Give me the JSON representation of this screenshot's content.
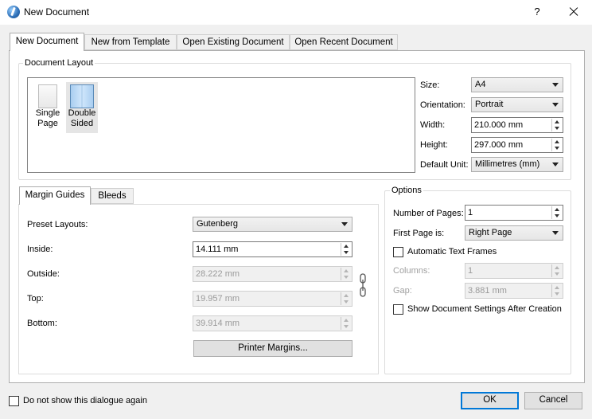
{
  "window": {
    "title": "New Document",
    "help": "?"
  },
  "tabs": [
    {
      "label": "New Document"
    },
    {
      "label": "New from Template"
    },
    {
      "label": "Open Existing Document"
    },
    {
      "label": "Open Recent Document"
    }
  ],
  "layout_group": {
    "title": "Document Layout",
    "options": [
      {
        "label": "Single Page",
        "line1": "Single",
        "line2": "Page"
      },
      {
        "label": "Double Sided",
        "line1": "Double",
        "line2": "Sided"
      }
    ],
    "size_label": "Size:",
    "size_value": "A4",
    "orientation_label": "Orientation:",
    "orientation_value": "Portrait",
    "width_label": "Width:",
    "width_value": "210.000 mm",
    "height_label": "Height:",
    "height_value": "297.000 mm",
    "unit_label": "Default Unit:",
    "unit_value": "Millimetres (mm)"
  },
  "margin_tabs": [
    {
      "label": "Margin Guides"
    },
    {
      "label": "Bleeds"
    }
  ],
  "margins": {
    "preset_label": "Preset Layouts:",
    "preset_value": "Gutenberg",
    "inside_label": "Inside:",
    "inside_value": "14.111 mm",
    "outside_label": "Outside:",
    "outside_value": "28.222 mm",
    "top_label": "Top:",
    "top_value": "19.957 mm",
    "bottom_label": "Bottom:",
    "bottom_value": "39.914 mm",
    "printer_margins_label": "Printer Margins..."
  },
  "options": {
    "title": "Options",
    "pages_label": "Number of Pages:",
    "pages_value": "1",
    "first_page_label": "First Page is:",
    "first_page_value": "Right Page",
    "auto_frames_label": "Automatic Text Frames",
    "columns_label": "Columns:",
    "columns_value": "1",
    "gap_label": "Gap:",
    "gap_value": "3.881 mm",
    "show_settings_label": "Show Document Settings After Creation"
  },
  "footer": {
    "dont_show_label": "Do not show this dialogue again",
    "ok_label": "OK",
    "cancel_label": "Cancel"
  }
}
